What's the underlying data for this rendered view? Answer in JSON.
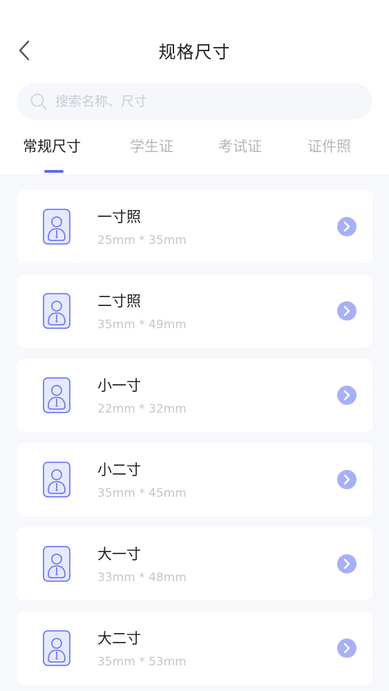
{
  "header": {
    "title": "规格尺寸",
    "back_icon": "chevron-left-icon"
  },
  "search": {
    "placeholder": "搜索名称、尺寸",
    "value": ""
  },
  "tabs": [
    {
      "label": "常规尺寸",
      "active": true
    },
    {
      "label": "学生证",
      "active": false
    },
    {
      "label": "考试证",
      "active": false
    },
    {
      "label": "证件照",
      "active": false
    }
  ],
  "sizes": [
    {
      "name": "一寸照",
      "dimensions": "25mm * 35mm"
    },
    {
      "name": "二寸照",
      "dimensions": "35mm * 49mm"
    },
    {
      "name": "小一寸",
      "dimensions": "22mm * 32mm"
    },
    {
      "name": "小二寸",
      "dimensions": "35mm * 45mm"
    },
    {
      "name": "大一寸",
      "dimensions": "33mm * 48mm"
    },
    {
      "name": "大二寸",
      "dimensions": "35mm * 53mm"
    }
  ],
  "colors": {
    "accent": "#5b6cf0",
    "arrow": "#a7b0f7",
    "icon_fill": "#e6e9fc",
    "icon_stroke": "#6f7cf2"
  }
}
